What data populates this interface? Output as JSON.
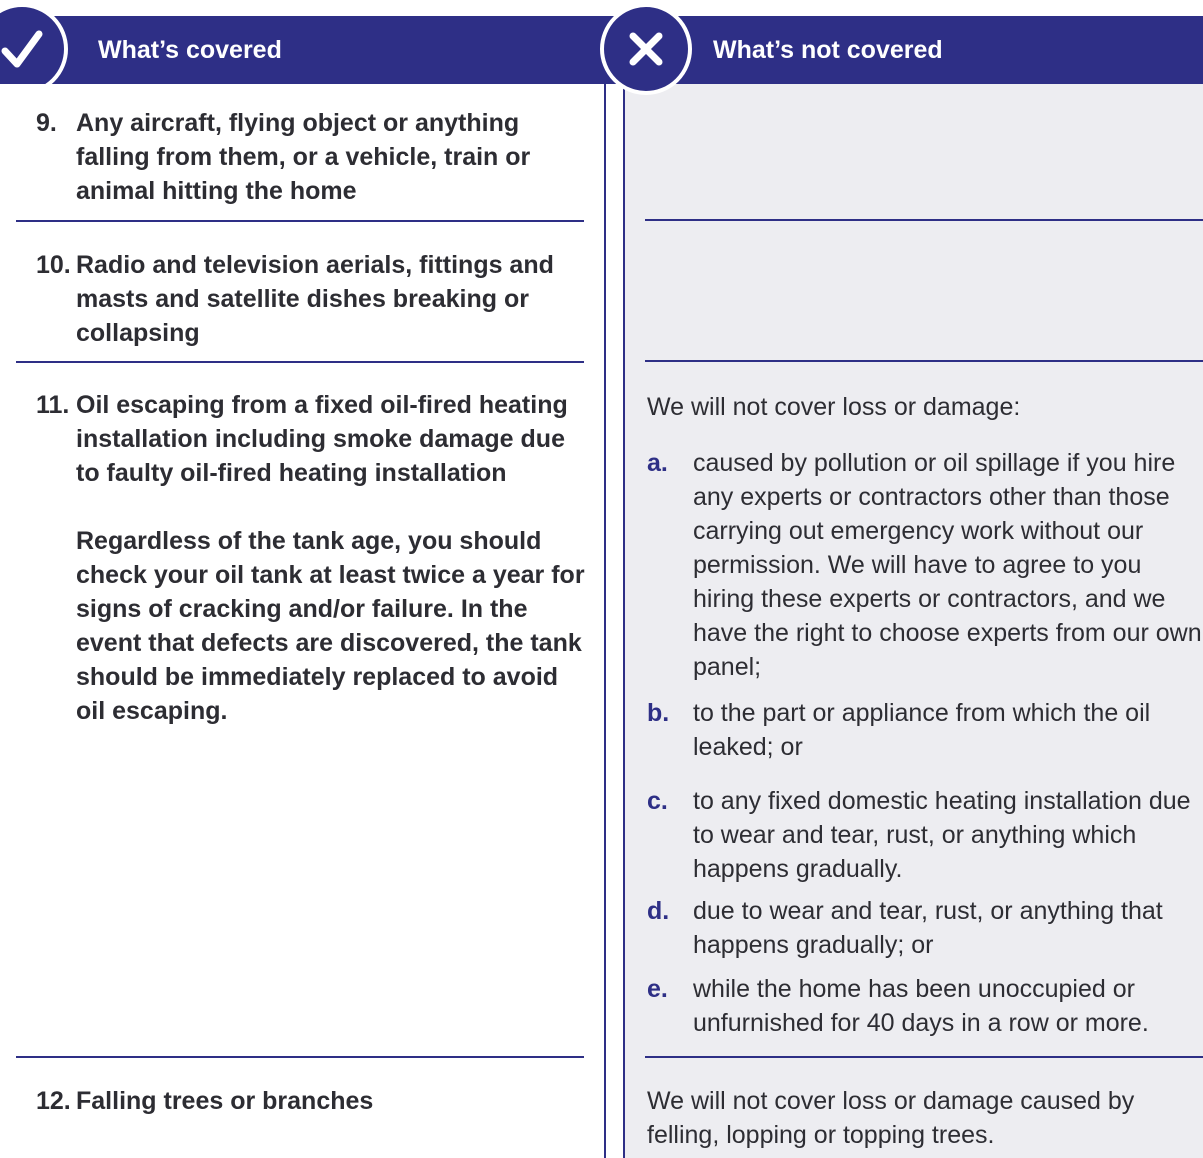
{
  "covered": {
    "title": "What’s covered",
    "items": [
      {
        "num": "9.",
        "text": "Any aircraft, flying object or anything falling from them, or a vehicle, train or animal hitting the home"
      },
      {
        "num": "10.",
        "text": "Radio and television aerials, fittings and masts and satellite dishes breaking or collapsing"
      },
      {
        "num": "11.",
        "text": "Oil escaping from a fixed oil-fired heating installation including smoke damage due to faulty oil-fired heating installation",
        "note": "Regardless of the tank age, you should check your oil tank at least twice a year for signs of cracking and/or failure. In the event that defects are discovered, the tank should be immediately replaced to avoid oil escaping."
      },
      {
        "num": "12.",
        "text": "Falling trees or branches"
      }
    ]
  },
  "not_covered": {
    "title": "What’s not covered",
    "oil_intro": "We will not cover loss or damage:",
    "oil_exclusions": [
      {
        "letter": "a.",
        "text": "caused by pollution or oil spillage if you hire any experts or contractors other than those carrying out emergency work without our permission. We will have to agree to you hiring these experts or contractors, and we have the right to choose experts from our own panel;"
      },
      {
        "letter": "b.",
        "text": "to the part or appliance from which the oil leaked; or"
      },
      {
        "letter": "c.",
        "text": "to any fixed domestic heating installation due to wear and tear, rust, or anything which happens gradually."
      },
      {
        "letter": "d.",
        "text": "due to wear and tear, rust, or anything that happens gradually; or"
      },
      {
        "letter": "e.",
        "text": "while the home has been unoccupied or unfurnished for 40 days in a row or more."
      }
    ],
    "trees_text": "We will not cover loss or damage caused by felling, lopping or topping trees."
  },
  "colors": {
    "brand": "#2e2f86",
    "panel": "#ededf1"
  },
  "icons": {
    "covered": "checkmark-icon",
    "not_covered": "cross-icon"
  }
}
